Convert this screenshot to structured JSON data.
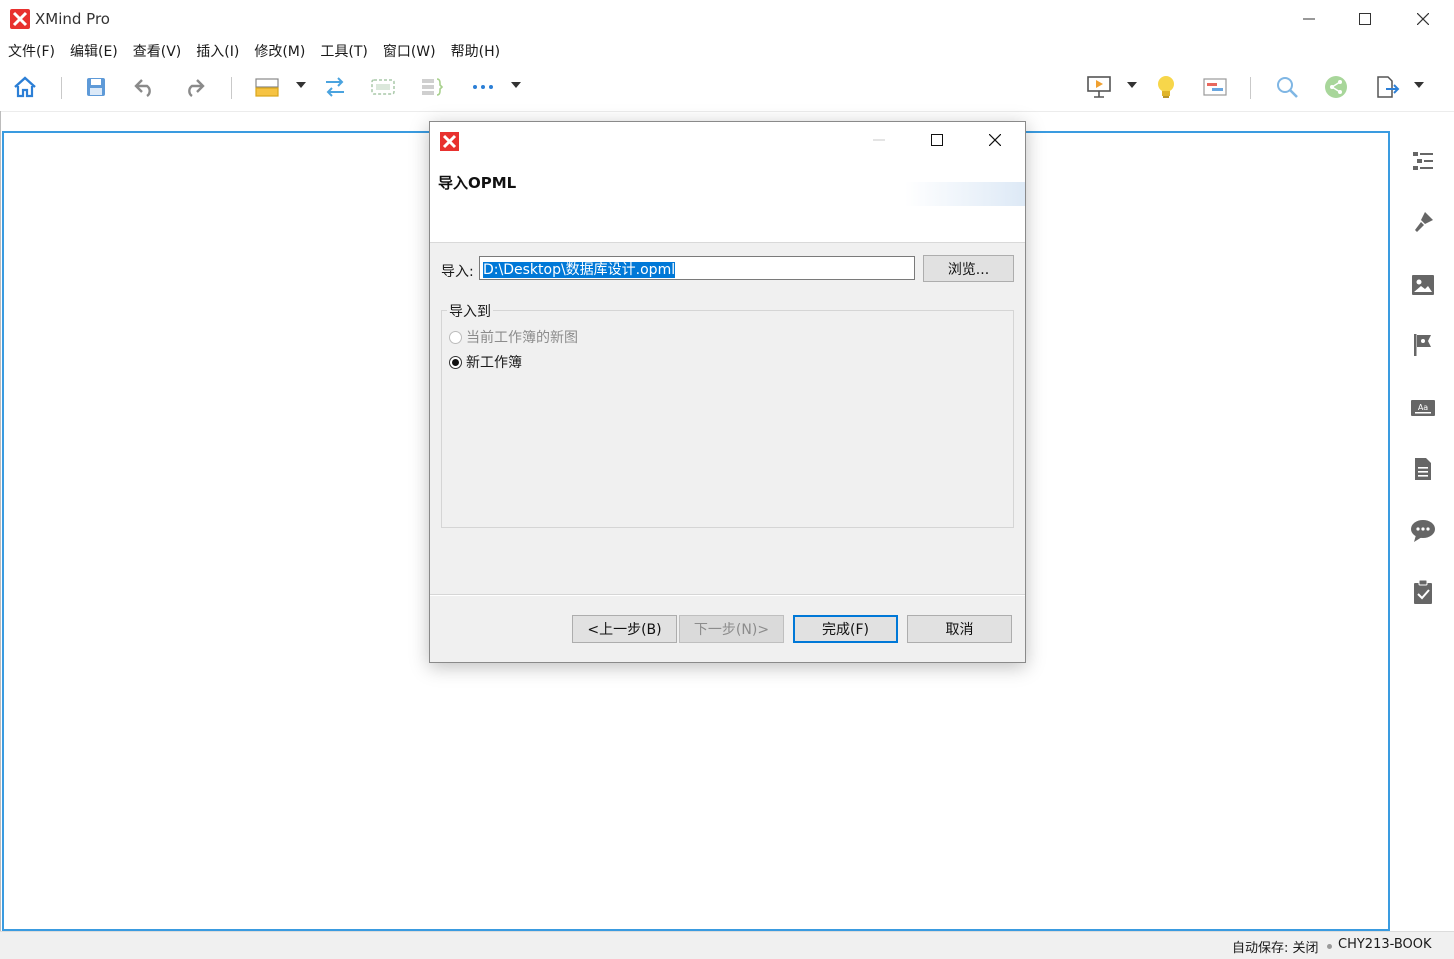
{
  "app": {
    "title": "XMind Pro"
  },
  "menu": [
    {
      "label": "文件(F)"
    },
    {
      "label": "编辑(E)"
    },
    {
      "label": "查看(V)"
    },
    {
      "label": "插入(I)"
    },
    {
      "label": "修改(M)"
    },
    {
      "label": "工具(T)"
    },
    {
      "label": "窗口(W)"
    },
    {
      "label": "帮助(H)"
    }
  ],
  "toolbar": {
    "icons": [
      "home-icon",
      "save-icon",
      "undo-icon",
      "redo-icon",
      "topic-icon",
      "relationship-icon",
      "boundary-icon",
      "summary-icon",
      "more-icon",
      "presentation-icon",
      "brainstorm-icon",
      "gantt-icon",
      "search-icon",
      "share-icon",
      "export-icon"
    ]
  },
  "side_panel": {
    "icons": [
      "outline-icon",
      "format-icon",
      "image-icon",
      "marker-icon",
      "text-icon",
      "notes-icon",
      "comment-icon",
      "task-icon"
    ]
  },
  "status": {
    "autosave": "自动保存: 关闭",
    "user": "CHY213-BOOK"
  },
  "dialog": {
    "heading": "导入OPML",
    "import_label": "导入:",
    "import_value": "D:\\Desktop\\数据库设计.opml",
    "browse_label": "浏览...",
    "group_title": "导入到",
    "options": [
      {
        "label": "当前工作簿的新图",
        "enabled": false,
        "checked": false
      },
      {
        "label": "新工作簿",
        "enabled": true,
        "checked": true
      }
    ],
    "buttons": {
      "back": "<上一步(B)",
      "next": "下一步(N)>",
      "finish": "完成(F)",
      "cancel": "取消"
    }
  },
  "colors": {
    "accent": "#3a9be0",
    "brand": "#e8312f",
    "selection": "#0078d7"
  }
}
